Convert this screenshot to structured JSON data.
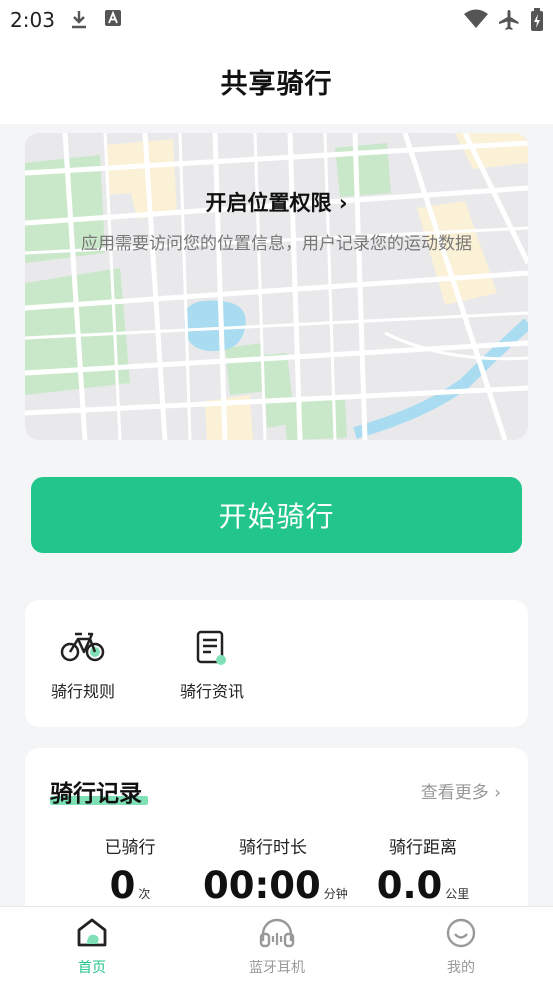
{
  "status_bar": {
    "time": "2:03"
  },
  "header": {
    "title": "共享骑行"
  },
  "map": {
    "title": "开启位置权限",
    "arrow": "›",
    "subtitle": "应用需要访问您的位置信息，用户记录您的运动数据"
  },
  "start_button": {
    "label": "开始骑行",
    "color": "#23c68a"
  },
  "quick_links": [
    {
      "label": "骑行规则",
      "icon": "bicycle-icon"
    },
    {
      "label": "骑行资讯",
      "icon": "document-icon"
    }
  ],
  "records": {
    "title": "骑行记录",
    "more": "查看更多",
    "more_arrow": "›",
    "stats": [
      {
        "label": "已骑行",
        "value": "0",
        "unit": "次"
      },
      {
        "label": "骑行时长",
        "value": "00:00",
        "unit": "分钟"
      },
      {
        "label": "骑行距离",
        "value": "0.0",
        "unit": "公里"
      }
    ]
  },
  "tabs": [
    {
      "label": "首页",
      "icon": "home-icon",
      "active": true,
      "color": "#23c68a"
    },
    {
      "label": "蓝牙耳机",
      "icon": "headphones-icon",
      "active": false,
      "color": "#999999"
    },
    {
      "label": "我的",
      "icon": "smiley-icon",
      "active": false,
      "color": "#999999"
    }
  ]
}
